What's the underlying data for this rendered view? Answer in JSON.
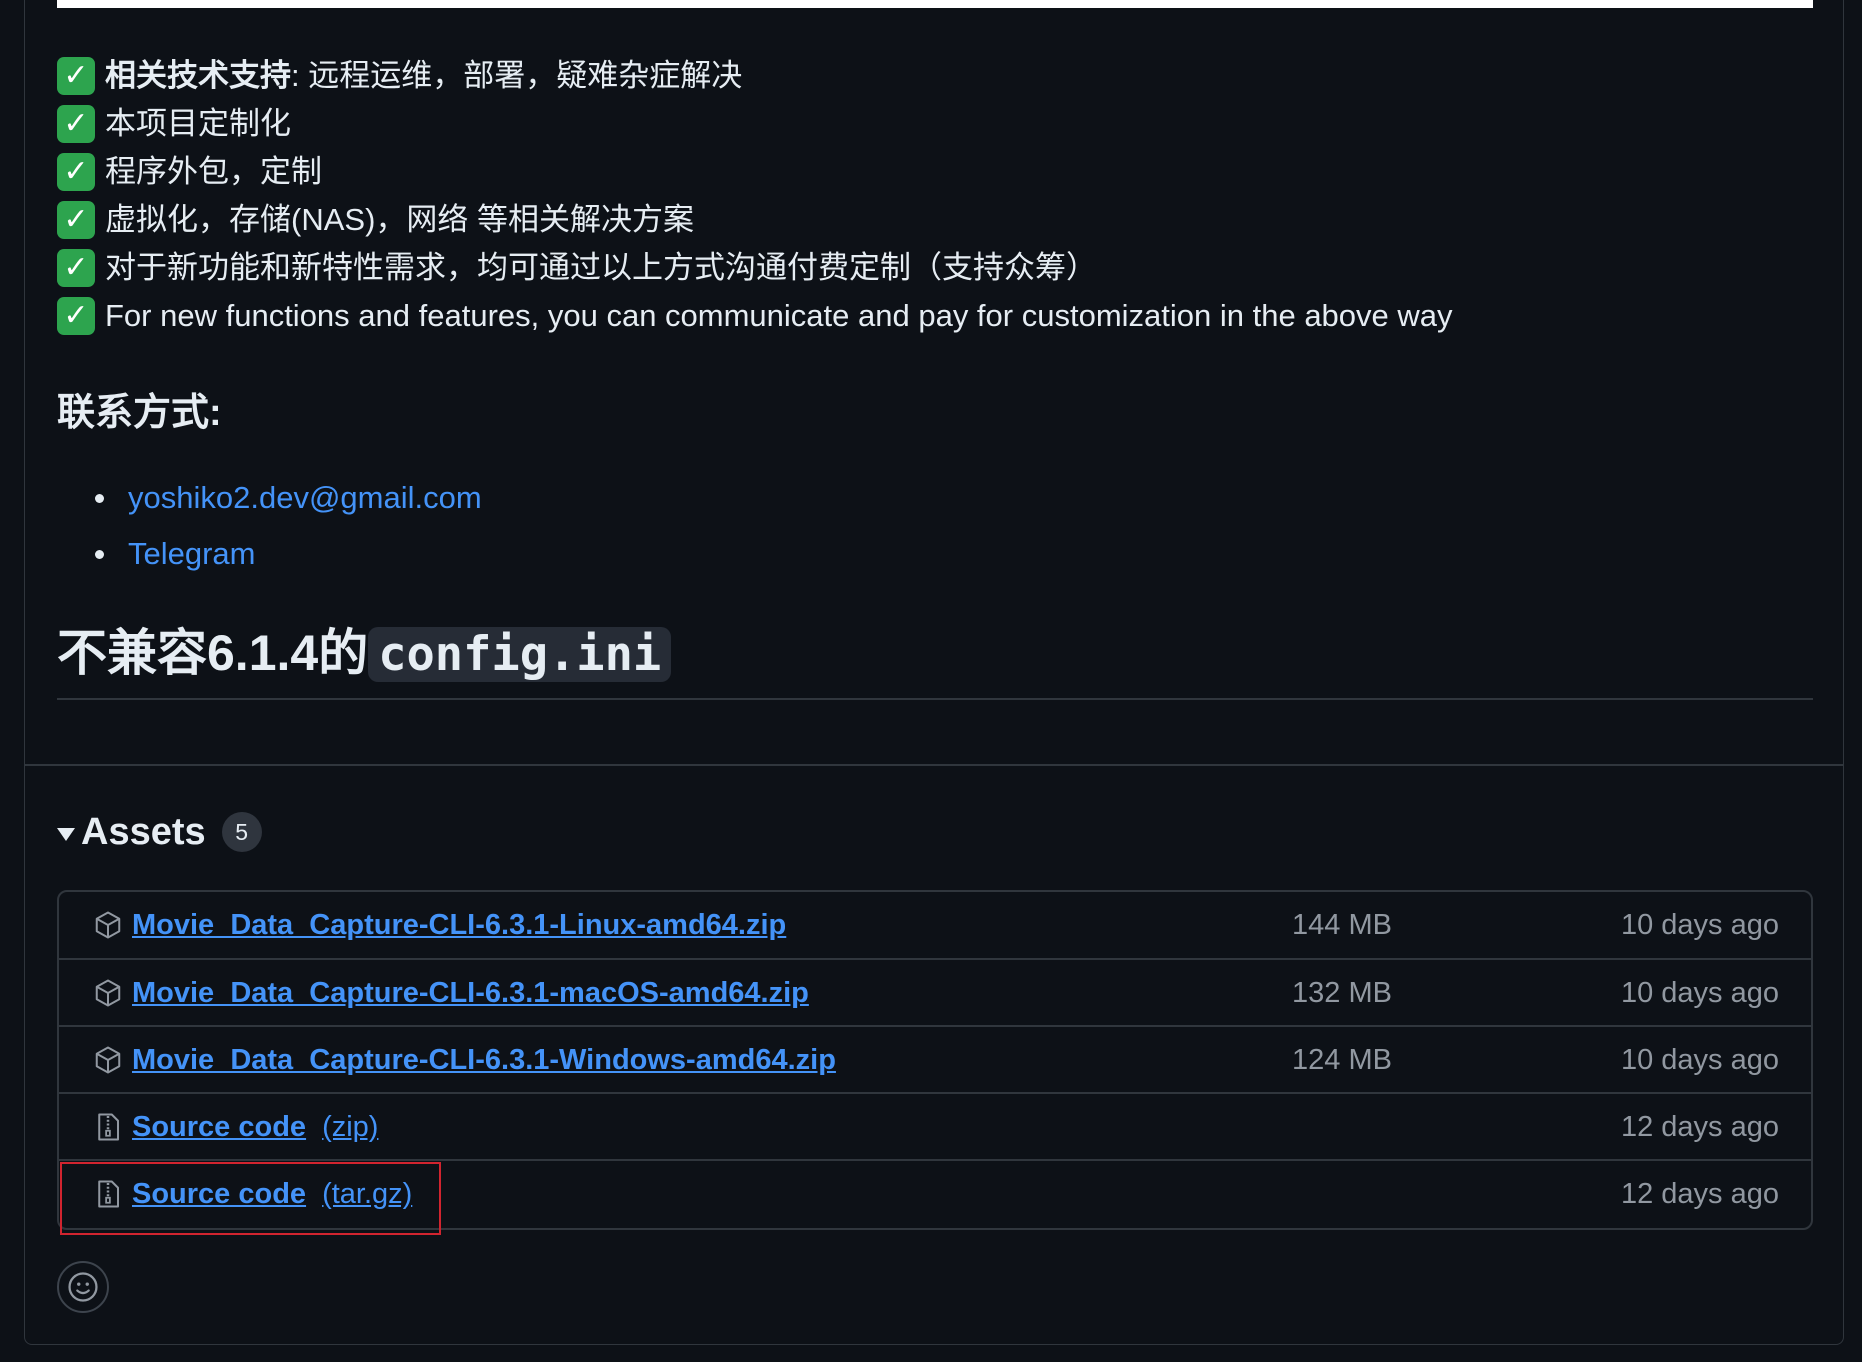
{
  "release_notes": {
    "features": [
      {
        "label": "相关技术支持",
        "text": ": 远程运维，部署，疑难杂症解决"
      },
      {
        "label": "",
        "text": "本项目定制化"
      },
      {
        "label": "",
        "text": "程序外包，定制"
      },
      {
        "label": "",
        "text": "虚拟化，存储(NAS)，网络 等相关解决方案"
      },
      {
        "label": "",
        "text": "对于新功能和新特性需求，均可通过以上方式沟通付费定制（支持众筹）"
      },
      {
        "label": "",
        "text": "For new functions and features, you can communicate and pay for customization in the above way"
      }
    ],
    "check_glyph": "✓",
    "contact_heading": "联系方式:",
    "contacts": [
      {
        "label": "yoshiko2.dev@gmail.com"
      },
      {
        "label": "Telegram"
      }
    ],
    "compat_heading_text": "不兼容6.1.4的",
    "compat_heading_code": "config.ini"
  },
  "assets": {
    "title": "Assets",
    "count": "5",
    "rows": [
      {
        "icon": "package-icon",
        "name": "Movie_Data_Capture-CLI-6.3.1-Linux-amd64.zip",
        "suffix": "",
        "size": "144 MB",
        "date": "10 days ago"
      },
      {
        "icon": "package-icon",
        "name": "Movie_Data_Capture-CLI-6.3.1-macOS-amd64.zip",
        "suffix": "",
        "size": "132 MB",
        "date": "10 days ago"
      },
      {
        "icon": "package-icon",
        "name": "Movie_Data_Capture-CLI-6.3.1-Windows-amd64.zip",
        "suffix": "",
        "size": "124 MB",
        "date": "10 days ago"
      },
      {
        "icon": "file-zip-icon",
        "name": "Source code",
        "suffix": "(zip)",
        "size": "",
        "date": "12 days ago"
      },
      {
        "icon": "file-zip-icon",
        "name": "Source code",
        "suffix": "(tar.gz)",
        "size": "",
        "date": "12 days ago"
      }
    ]
  },
  "colors": {
    "background": "#0d1117",
    "text": "#e6edf3",
    "link": "#4493f8",
    "muted": "#9198a1",
    "border": "#30363d",
    "check": "#2da44e",
    "highlight": "#d1242f"
  }
}
